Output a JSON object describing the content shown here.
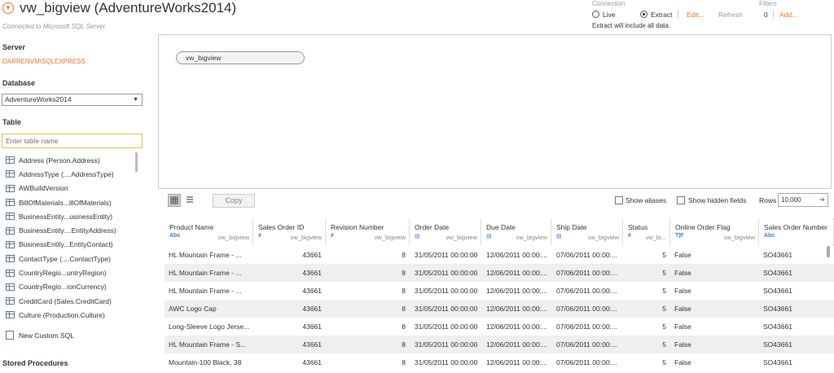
{
  "header": {
    "title": "vw_bigview (AdventureWorks2014)",
    "subtitle": "Connected to Microsoft SQL Server",
    "title_icon": "circle-chevron-down-icon"
  },
  "left": {
    "server_label": "Server",
    "server_value": "DARRENVM\\SQLEXPRESS",
    "database_label": "Database",
    "database_value": "AdventureWorks2014",
    "table_label": "Table",
    "table_search_placeholder": "Enter table name",
    "tables": [
      "Address (Person.Address)",
      "AddressType (....AddressType)",
      "AWBuildVersion",
      "BillOfMaterials...illOfMaterials)",
      "BusinessEntity...usinessEntity)",
      "BusinessEntity....EntityAddress)",
      "BusinessEntity...EntityContact)",
      "ContactType (....ContactType)",
      "CountryRegio...untryRegion)",
      "CountryRegio...ionCurrency)",
      "CreditCard (Sales.CreditCard)",
      "Culture (Production.Culture)"
    ],
    "custom_sql": "New Custom SQL",
    "stored_procedures": "Stored Procedures"
  },
  "connection": {
    "label": "Connection",
    "live": "Live",
    "extract": "Extract",
    "selected": "Extract",
    "edit": "Edit...",
    "refresh": "Refresh",
    "note": "Extract will include all data.",
    "filters_label": "Filters",
    "filters_count": "0",
    "add": "Add..."
  },
  "canvas": {
    "table_pill": "vw_bigview"
  },
  "toolbar": {
    "copy": "Copy",
    "show_aliases": "Show aliases",
    "show_hidden": "Show hidden fields",
    "rows_label": "Rows",
    "rows_value": "10,000"
  },
  "grid": {
    "columns": [
      {
        "name": "Product Name",
        "type": "Abc",
        "source": "vw_bigview"
      },
      {
        "name": "Sales Order ID",
        "type": "#",
        "source": "vw_bigview"
      },
      {
        "name": "Revision Number",
        "type": "#",
        "source": "vw_bigview"
      },
      {
        "name": "Order Date",
        "type": "date",
        "source": "vw_bigview"
      },
      {
        "name": "Due Date",
        "type": "date",
        "source": "vw_bigview"
      },
      {
        "name": "Ship Date",
        "type": "date",
        "source": "vw_bigview"
      },
      {
        "name": "Status",
        "type": "#",
        "source": "vw_bi..."
      },
      {
        "name": "Online Order Flag",
        "type": "T|F",
        "source": "vw_bigview"
      },
      {
        "name": "Sales Order Number",
        "type": "Abc",
        "source": ""
      }
    ],
    "rows": [
      [
        "HL Mountain Frame - ...",
        "43661",
        "8",
        "31/05/2011 00:00:00",
        "12/06/2011 00:00:...",
        "07/06/2011 00:00:...",
        "5",
        "False",
        "SO43661"
      ],
      [
        "HL Mountain Frame - ...",
        "43661",
        "8",
        "31/05/2011 00:00:00",
        "12/06/2011 00:00:...",
        "07/06/2011 00:00:...",
        "5",
        "False",
        "SO43661"
      ],
      [
        "HL Mountain Frame - ...",
        "43661",
        "8",
        "31/05/2011 00:00:00",
        "12/06/2011 00:00:...",
        "07/06/2011 00:00:...",
        "5",
        "False",
        "SO43661"
      ],
      [
        "AWC Logo Cap",
        "43661",
        "8",
        "31/05/2011 00:00:00",
        "12/06/2011 00:00:...",
        "07/06/2011 00:00:...",
        "5",
        "False",
        "SO43661"
      ],
      [
        "Long-Sleeve Logo Jerse...",
        "43661",
        "8",
        "31/05/2011 00:00:00",
        "12/06/2011 00:00:...",
        "07/06/2011 00:00:...",
        "5",
        "False",
        "SO43661"
      ],
      [
        "HL Mountain Frame - S...",
        "43661",
        "8",
        "31/05/2011 00:00:00",
        "12/06/2011 00:00:...",
        "07/06/2011 00:00:...",
        "5",
        "False",
        "SO43661"
      ],
      [
        "Mountain-100 Black, 38",
        "43661",
        "8",
        "31/05/2011 00:00:00",
        "12/06/2011 00:00:...",
        "07/06/2011 00:00:...",
        "5",
        "False",
        "SO43661"
      ]
    ]
  },
  "colors": {
    "accent": "#e8762d",
    "type_blue": "#3c7dc4"
  }
}
